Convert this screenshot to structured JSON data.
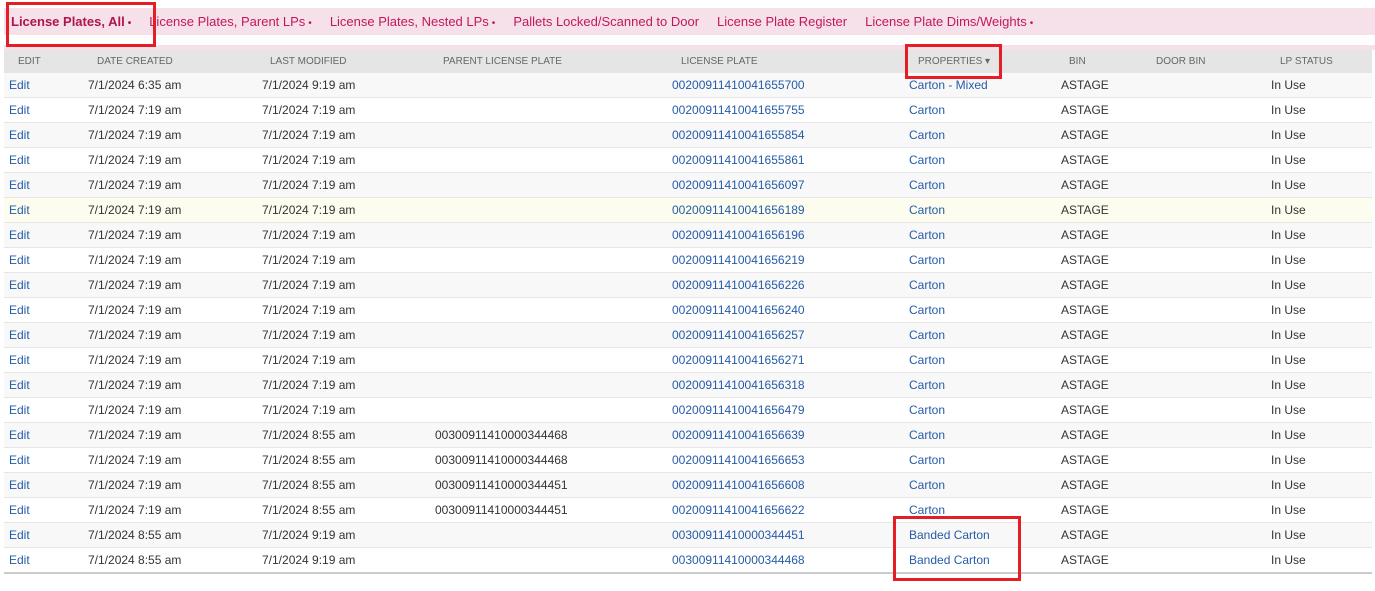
{
  "tabs": [
    {
      "label": "License Plates, All",
      "dot": "•"
    },
    {
      "label": "License Plates, Parent LPs",
      "dot": "•"
    },
    {
      "label": "License Plates, Nested LPs",
      "dot": "•"
    },
    {
      "label": "Pallets Locked/Scanned to Door",
      "dot": ""
    },
    {
      "label": "License Plate Register",
      "dot": ""
    },
    {
      "label": "License Plate Dims/Weights",
      "dot": "•"
    }
  ],
  "columns": [
    "EDIT",
    "DATE CREATED",
    "LAST MODIFIED",
    "PARENT LICENSE PLATE",
    "LICENSE PLATE",
    "PROPERTIES ▾",
    "BIN",
    "DOOR BIN",
    "LP STATUS"
  ],
  "colors": {
    "tab_bg": "#f6e0ea",
    "tab_text": "#c2185b",
    "link": "#255ba8",
    "highlight_box": "#e51e25",
    "hover_row": "#fcfdef"
  },
  "rows": [
    [
      "Edit",
      "7/1/2024 6:35 am",
      "7/1/2024 9:19 am",
      "",
      "00200911410041655700",
      "Carton - Mixed",
      "ASTAGE",
      "",
      "In Use"
    ],
    [
      "Edit",
      "7/1/2024 7:19 am",
      "7/1/2024 7:19 am",
      "",
      "00200911410041655755",
      "Carton",
      "ASTAGE",
      "",
      "In Use"
    ],
    [
      "Edit",
      "7/1/2024 7:19 am",
      "7/1/2024 7:19 am",
      "",
      "00200911410041655854",
      "Carton",
      "ASTAGE",
      "",
      "In Use"
    ],
    [
      "Edit",
      "7/1/2024 7:19 am",
      "7/1/2024 7:19 am",
      "",
      "00200911410041655861",
      "Carton",
      "ASTAGE",
      "",
      "In Use"
    ],
    [
      "Edit",
      "7/1/2024 7:19 am",
      "7/1/2024 7:19 am",
      "",
      "00200911410041656097",
      "Carton",
      "ASTAGE",
      "",
      "In Use"
    ],
    [
      "Edit",
      "7/1/2024 7:19 am",
      "7/1/2024 7:19 am",
      "",
      "00200911410041656189",
      "Carton",
      "ASTAGE",
      "",
      "In Use"
    ],
    [
      "Edit",
      "7/1/2024 7:19 am",
      "7/1/2024 7:19 am",
      "",
      "00200911410041656196",
      "Carton",
      "ASTAGE",
      "",
      "In Use"
    ],
    [
      "Edit",
      "7/1/2024 7:19 am",
      "7/1/2024 7:19 am",
      "",
      "00200911410041656219",
      "Carton",
      "ASTAGE",
      "",
      "In Use"
    ],
    [
      "Edit",
      "7/1/2024 7:19 am",
      "7/1/2024 7:19 am",
      "",
      "00200911410041656226",
      "Carton",
      "ASTAGE",
      "",
      "In Use"
    ],
    [
      "Edit",
      "7/1/2024 7:19 am",
      "7/1/2024 7:19 am",
      "",
      "00200911410041656240",
      "Carton",
      "ASTAGE",
      "",
      "In Use"
    ],
    [
      "Edit",
      "7/1/2024 7:19 am",
      "7/1/2024 7:19 am",
      "",
      "00200911410041656257",
      "Carton",
      "ASTAGE",
      "",
      "In Use"
    ],
    [
      "Edit",
      "7/1/2024 7:19 am",
      "7/1/2024 7:19 am",
      "",
      "00200911410041656271",
      "Carton",
      "ASTAGE",
      "",
      "In Use"
    ],
    [
      "Edit",
      "7/1/2024 7:19 am",
      "7/1/2024 7:19 am",
      "",
      "00200911410041656318",
      "Carton",
      "ASTAGE",
      "",
      "In Use"
    ],
    [
      "Edit",
      "7/1/2024 7:19 am",
      "7/1/2024 7:19 am",
      "",
      "00200911410041656479",
      "Carton",
      "ASTAGE",
      "",
      "In Use"
    ],
    [
      "Edit",
      "7/1/2024 7:19 am",
      "7/1/2024 8:55 am",
      "00300911410000344468",
      "00200911410041656639",
      "Carton",
      "ASTAGE",
      "",
      "In Use"
    ],
    [
      "Edit",
      "7/1/2024 7:19 am",
      "7/1/2024 8:55 am",
      "00300911410000344468",
      "00200911410041656653",
      "Carton",
      "ASTAGE",
      "",
      "In Use"
    ],
    [
      "Edit",
      "7/1/2024 7:19 am",
      "7/1/2024 8:55 am",
      "00300911410000344451",
      "00200911410041656608",
      "Carton",
      "ASTAGE",
      "",
      "In Use"
    ],
    [
      "Edit",
      "7/1/2024 7:19 am",
      "7/1/2024 8:55 am",
      "00300911410000344451",
      "00200911410041656622",
      "Carton",
      "ASTAGE",
      "",
      "In Use"
    ],
    [
      "Edit",
      "7/1/2024 8:55 am",
      "7/1/2024 9:19 am",
      "",
      "00300911410000344451",
      "Banded Carton",
      "ASTAGE",
      "",
      "In Use"
    ],
    [
      "Edit",
      "7/1/2024 8:55 am",
      "7/1/2024 9:19 am",
      "",
      "00300911410000344468",
      "Banded Carton",
      "ASTAGE",
      "",
      "In Use"
    ]
  ]
}
